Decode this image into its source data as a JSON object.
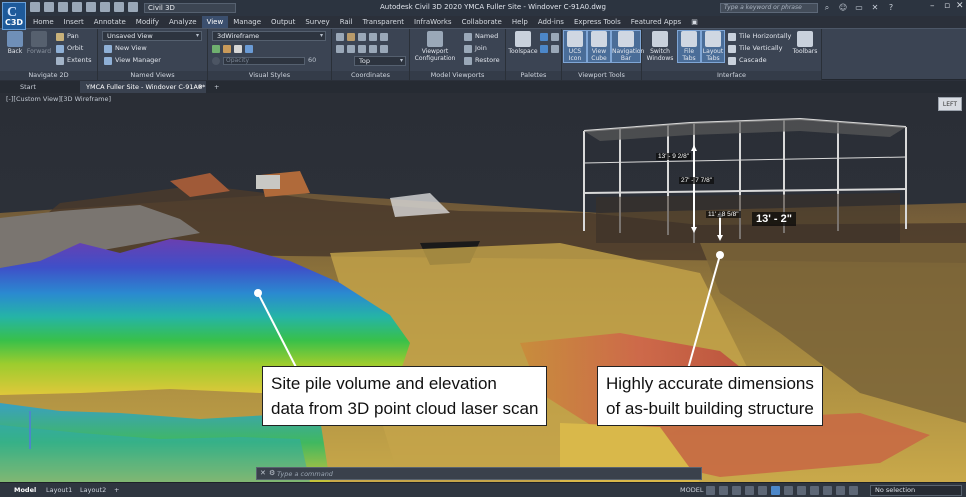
{
  "app": {
    "logo_text": "C3D",
    "title": "Autodesk Civil 3D 2020   YMCA Fuller Site - Windover C-91A0.dwg",
    "workspace": "Civil 3D",
    "search_placeholder": "Type a keyword or phrase"
  },
  "menu_tabs": [
    "Home",
    "Insert",
    "Annotate",
    "Modify",
    "Analyze",
    "View",
    "Manage",
    "Output",
    "Survey",
    "Rail",
    "Transparent",
    "InfraWorks",
    "Collaborate",
    "Help",
    "Add-ins",
    "Express Tools",
    "Featured Apps"
  ],
  "active_menu_tab": "View",
  "ribbon": {
    "navigate2d": {
      "label": "Navigate 2D",
      "back": "Back",
      "forward": "Forward",
      "pan": "Pan",
      "orbit": "Orbit",
      "extents": "Extents"
    },
    "named_views": {
      "label": "Named Views",
      "current": "Unsaved View",
      "new_view": "New View",
      "view_manager": "View Manager"
    },
    "visual_styles": {
      "label": "Visual Styles",
      "current": "3dWireframe",
      "opacity_placeholder": "Opacity",
      "opacity_value": "60"
    },
    "coordinates": {
      "label": "Coordinates",
      "ucs_dropdown": "Top"
    },
    "model_viewports": {
      "label": "Model Viewports",
      "viewport_config": "Viewport Configuration",
      "named": "Named",
      "join": "Join",
      "restore": "Restore"
    },
    "palettes": {
      "label": "Palettes",
      "toolspace": "Toolspace"
    },
    "viewport_tools": {
      "label": "Viewport Tools",
      "ucs_icon": "UCS Icon",
      "view_cube": "View Cube",
      "navigation_bar": "Navigation Bar"
    },
    "interface": {
      "label": "Interface",
      "switch_windows": "Switch Windows",
      "file_tabs": "File Tabs",
      "layout_tabs": "Layout Tabs",
      "tile_horizontally": "Tile Horizontally",
      "tile_vertically": "Tile Vertically",
      "cascade": "Cascade",
      "toolbars": "Toolbars"
    }
  },
  "doc_tabs": [
    "Start",
    "YMCA Fuller Site - Windover C-91A0*"
  ],
  "viewport": {
    "viewcube_label": "LEFT",
    "callout_left_line1": "Site pile volume and elevation",
    "callout_left_line2": "data from 3D point cloud laser scan",
    "callout_right_line1": "Highly accurate dimensions",
    "callout_right_line2": "of as-built building structure",
    "dimensions": [
      "13' - 9 2/8\"",
      "27' - 7 7/8\"",
      "11' - 8 5/8\"",
      "13' - 2\""
    ]
  },
  "command_line": {
    "placeholder": "Type a command"
  },
  "status": {
    "tabs": [
      "Model",
      "Layout1",
      "Layout2"
    ],
    "active_tab": "Model",
    "model_label": "MODEL",
    "selection": "No selection"
  },
  "colors": {
    "accent": "#4a6d98",
    "ribbon_bg": "#3b4453",
    "callout_bg": "#ffffff"
  }
}
